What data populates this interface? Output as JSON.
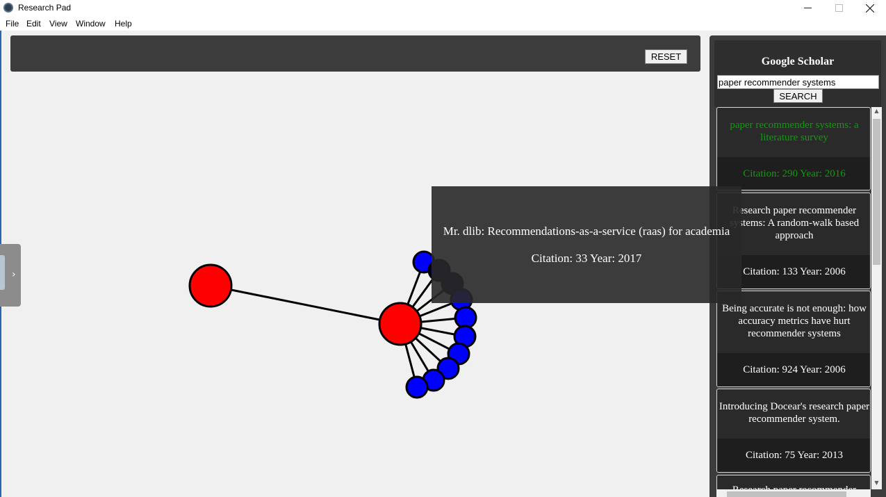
{
  "window": {
    "title": "Research Pad",
    "minimize_icon": "minimize-icon",
    "maximize_icon": "maximize-icon",
    "close_icon": "close-icon"
  },
  "menu": [
    "File",
    "Edit",
    "View",
    "Window",
    "Help"
  ],
  "toolbar": {
    "reset_label": "RESET"
  },
  "side_handle": {
    "icon": "chevron-right-icon"
  },
  "graph": {
    "node_color_paper": "#ff0000",
    "node_color_citation": "#0000ff",
    "node_color_hover": "#000033",
    "edge_color": "#000000",
    "nodes": [
      {
        "id": "root",
        "kind": "paper"
      },
      {
        "id": "selected",
        "kind": "paper"
      },
      {
        "id": "c1",
        "kind": "citation"
      },
      {
        "id": "c2",
        "kind": "citation-dim"
      },
      {
        "id": "c3",
        "kind": "citation-dim"
      },
      {
        "id": "c4",
        "kind": "citation"
      },
      {
        "id": "c5",
        "kind": "citation"
      },
      {
        "id": "c6",
        "kind": "citation"
      },
      {
        "id": "c7",
        "kind": "citation"
      },
      {
        "id": "c8",
        "kind": "citation"
      },
      {
        "id": "c9",
        "kind": "citation"
      },
      {
        "id": "c10",
        "kind": "citation"
      }
    ]
  },
  "tooltip": {
    "title": "Mr. dlib: Recommendations-as-a-service (raas) for academia",
    "meta": "Citation: 33 Year: 2017"
  },
  "scholar": {
    "title": "Google Scholar",
    "search_value": "paper recommender systems",
    "search_label": "SEARCH",
    "results": [
      {
        "title": "paper recommender systems: a literature survey",
        "meta": "Citation: 290 Year: 2016",
        "visited": true
      },
      {
        "title": "Research paper recommender systems: A random-walk based approach",
        "meta": "Citation: 133 Year: 2006",
        "visited": false
      },
      {
        "title": "Being accurate is not enough: how accuracy metrics have hurt recommender systems",
        "meta": "Citation: 924 Year: 2006",
        "visited": false
      },
      {
        "title": "Introducing Docear's research paper recommender system.",
        "meta": "Citation: 75 Year: 2013",
        "visited": false
      },
      {
        "title": "Research paper recommender",
        "meta": "",
        "visited": false
      }
    ]
  }
}
